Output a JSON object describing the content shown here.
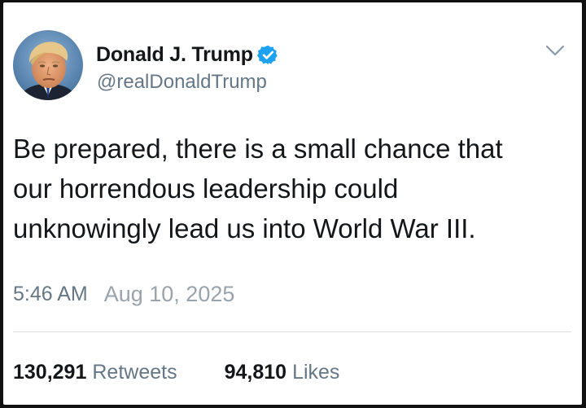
{
  "tweet": {
    "author": {
      "display_name": "Donald J. Trump",
      "handle": "@realDonaldTrump",
      "verified": true,
      "avatar_icon": "profile-photo",
      "verified_icon": "verified-badge-icon"
    },
    "menu_icon": "chevron-down-icon",
    "text_lines": [
      "Be prepared, there is a small chance that",
      "our horrendous leadership could",
      "unknowingly lead us into World War III."
    ],
    "time": "5:46 AM",
    "date": "Aug 10, 2025",
    "stats": {
      "retweets_count": "130,291",
      "retweets_label": "Retweets",
      "likes_count": "94,810",
      "likes_label": "Likes"
    }
  },
  "colors": {
    "verified_blue": "#1da1f2",
    "text": "#14171a",
    "secondary": "#657786"
  }
}
